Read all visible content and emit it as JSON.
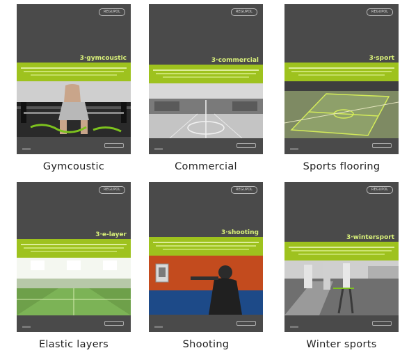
{
  "brochures": [
    {
      "label": "Gymcoustic",
      "brand": "3·gymcoustic",
      "logo": "REGUPOL"
    },
    {
      "label": "Commercial",
      "brand": "3·commercial",
      "logo": "REGUPOL"
    },
    {
      "label": "Sports flooring",
      "brand": "3·sport",
      "logo": "REGUPOL"
    },
    {
      "label": "Elastic layers",
      "brand": "3·e-layer",
      "logo": "REGUPOL"
    },
    {
      "label": "Shooting",
      "brand": "3·shooting",
      "logo": "REGUPOL"
    },
    {
      "label": "Winter sports",
      "brand": "3·wintersport",
      "logo": "REGUPOL"
    }
  ],
  "colors": {
    "cover": "#4a4a4a",
    "accent": "#9ec21e"
  }
}
